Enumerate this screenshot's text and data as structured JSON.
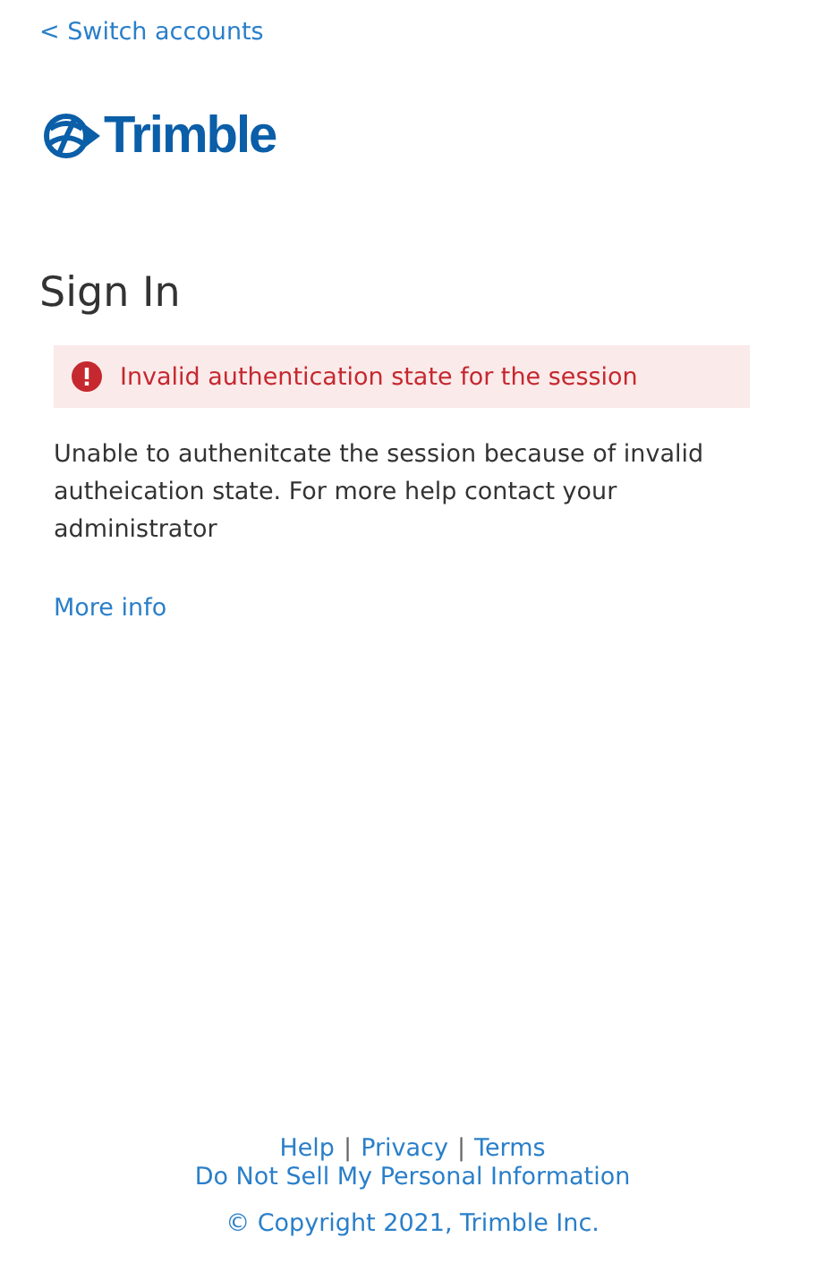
{
  "back_link": "< Switch accounts",
  "logo": {
    "text": "Trimble"
  },
  "title": "Sign In",
  "alert": {
    "message": "Invalid authentication state for the session"
  },
  "description": "Unable to authenitcate the session because of invalid autheication state. For more help contact your administrator",
  "more_info": "More info",
  "footer": {
    "links": [
      "Help",
      "Privacy",
      "Terms"
    ],
    "separator": "|",
    "privacy_link": "Do Not Sell My Personal Information",
    "copyright": "© Copyright 2021, Trimble Inc."
  }
}
